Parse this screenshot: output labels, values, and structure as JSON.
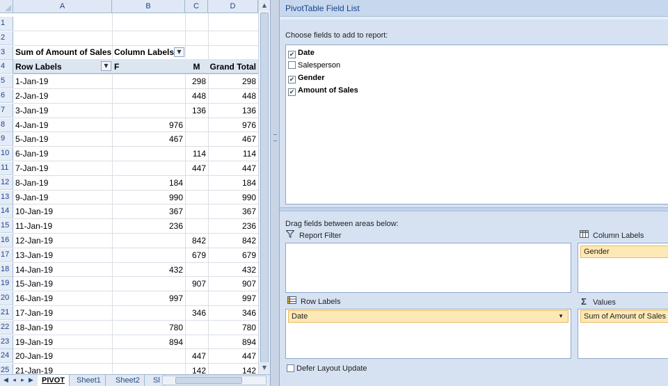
{
  "sheet": {
    "columns": [
      "A",
      "B",
      "C",
      "D"
    ],
    "row_numbers": [
      "1",
      "2",
      "3",
      "4",
      "5",
      "6",
      "7",
      "8",
      "9",
      "10",
      "11",
      "12",
      "13",
      "14",
      "15",
      "16",
      "17",
      "18",
      "19",
      "20",
      "21",
      "22",
      "23",
      "24",
      "25"
    ],
    "pivot_title": "Sum of Amount of Sales",
    "column_labels": "Column Labels",
    "row_labels": "Row Labels",
    "col_f": "F",
    "col_m": "M",
    "grand_total": "Grand Total",
    "rows": [
      {
        "date": "1-Jan-19",
        "f": "",
        "m": "298",
        "total": "298"
      },
      {
        "date": "2-Jan-19",
        "f": "",
        "m": "448",
        "total": "448"
      },
      {
        "date": "3-Jan-19",
        "f": "",
        "m": "136",
        "total": "136"
      },
      {
        "date": "4-Jan-19",
        "f": "976",
        "m": "",
        "total": "976"
      },
      {
        "date": "5-Jan-19",
        "f": "467",
        "m": "",
        "total": "467"
      },
      {
        "date": "6-Jan-19",
        "f": "",
        "m": "114",
        "total": "114"
      },
      {
        "date": "7-Jan-19",
        "f": "",
        "m": "447",
        "total": "447"
      },
      {
        "date": "8-Jan-19",
        "f": "184",
        "m": "",
        "total": "184"
      },
      {
        "date": "9-Jan-19",
        "f": "990",
        "m": "",
        "total": "990"
      },
      {
        "date": "10-Jan-19",
        "f": "367",
        "m": "",
        "total": "367"
      },
      {
        "date": "11-Jan-19",
        "f": "236",
        "m": "",
        "total": "236"
      },
      {
        "date": "12-Jan-19",
        "f": "",
        "m": "842",
        "total": "842"
      },
      {
        "date": "13-Jan-19",
        "f": "",
        "m": "679",
        "total": "679"
      },
      {
        "date": "14-Jan-19",
        "f": "432",
        "m": "",
        "total": "432"
      },
      {
        "date": "15-Jan-19",
        "f": "",
        "m": "907",
        "total": "907"
      },
      {
        "date": "16-Jan-19",
        "f": "997",
        "m": "",
        "total": "997"
      },
      {
        "date": "17-Jan-19",
        "f": "",
        "m": "346",
        "total": "346"
      },
      {
        "date": "18-Jan-19",
        "f": "780",
        "m": "",
        "total": "780"
      },
      {
        "date": "19-Jan-19",
        "f": "894",
        "m": "",
        "total": "894"
      },
      {
        "date": "20-Jan-19",
        "f": "",
        "m": "447",
        "total": "447"
      },
      {
        "date": "21-Jan-19",
        "f": "",
        "m": "142",
        "total": "142"
      }
    ],
    "tabs": [
      "PIVOT",
      "Sheet1",
      "Sheet2",
      "Sl"
    ],
    "active_tab": "PIVOT"
  },
  "field_list": {
    "title": "PivotTable Field List",
    "choose_label": "Choose fields to add to report:",
    "fields": [
      {
        "name": "Date",
        "checked": true
      },
      {
        "name": "Salesperson",
        "checked": false
      },
      {
        "name": "Gender",
        "checked": true
      },
      {
        "name": "Amount of Sales",
        "checked": true
      }
    ],
    "drag_label": "Drag fields between areas below:",
    "report_filter": "Report Filter",
    "column_labels": "Column Labels",
    "row_labels": "Row Labels",
    "values": "Values",
    "column_chip": "Gender",
    "row_chip": "Date",
    "values_chip": "Sum of Amount of Sales",
    "defer": "Defer Layout Update"
  },
  "icons": {
    "filter": "filter-icon",
    "column_labels": "column-labels-icon",
    "row_labels": "row-labels-icon",
    "values": "sigma-icon"
  },
  "colors": {
    "accent": "#15428b",
    "chip_fill": "#fde9b6",
    "pane_bg": "#d6e2f2"
  }
}
